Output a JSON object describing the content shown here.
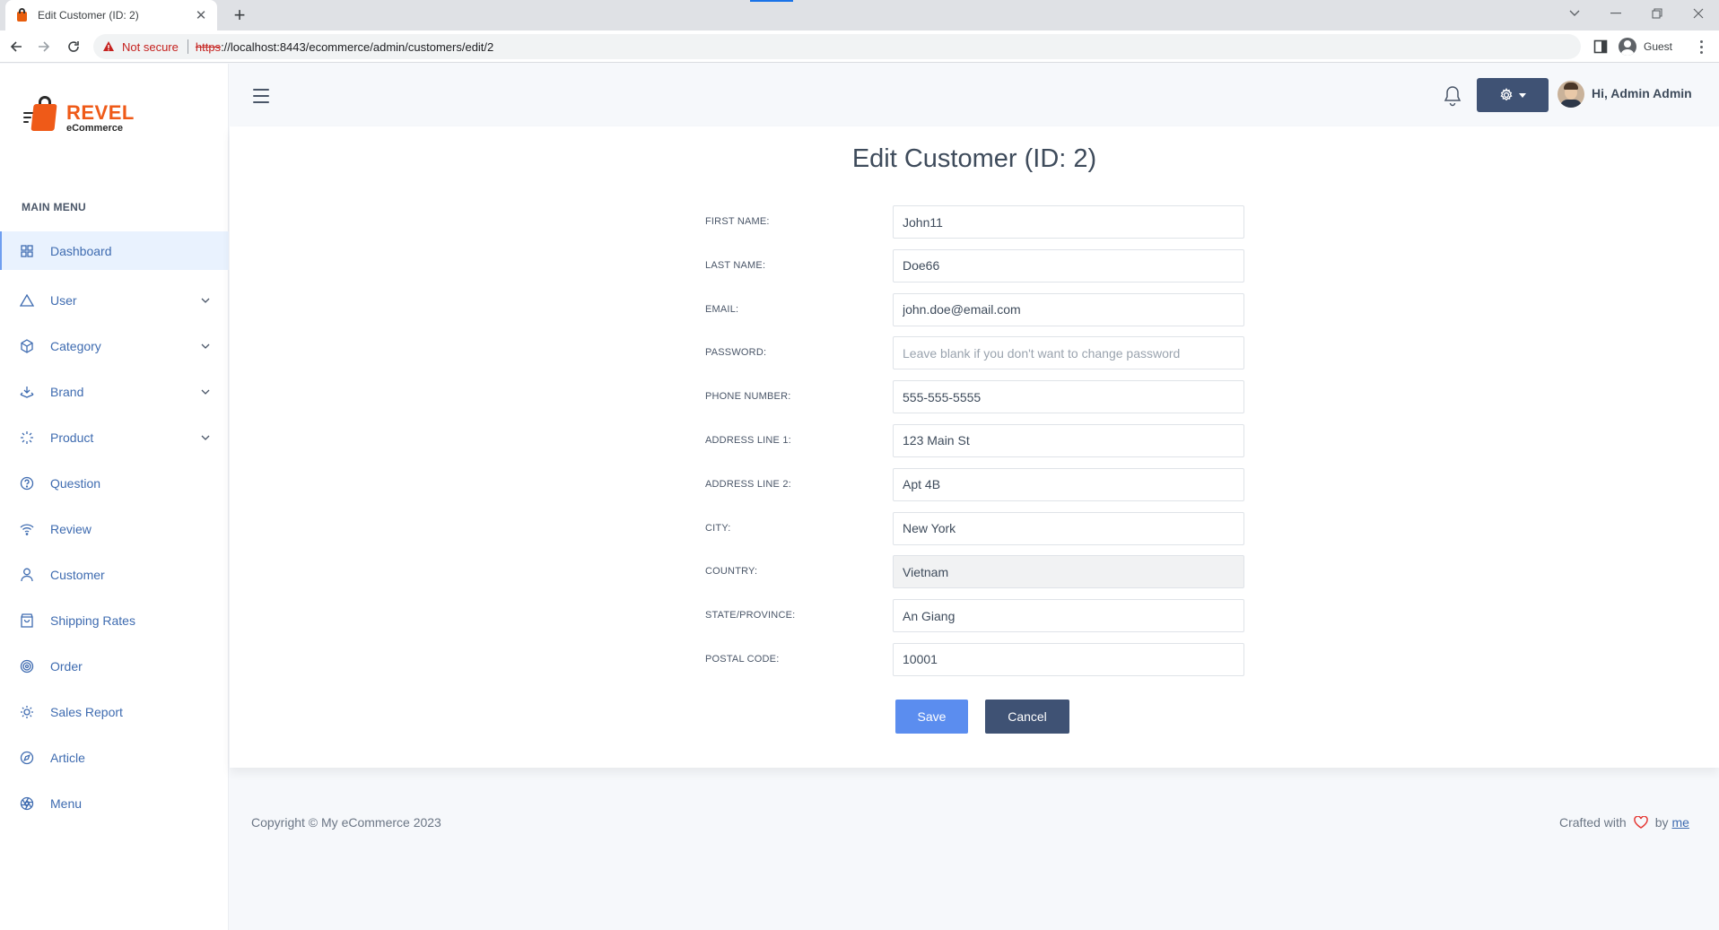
{
  "browser": {
    "tab_title": "Edit Customer (ID: 2)",
    "tab_close": "✕",
    "new_tab": "+",
    "not_secure": "Not secure",
    "url_scheme": "https",
    "url_rest": "://localhost:8443/ecommerce/admin/customers/edit/2",
    "profile_label": "Guest"
  },
  "logo": {
    "brand": "REVEL",
    "sub": "eCommerce",
    "brand_color": "#ef5a18"
  },
  "sidebar": {
    "title": "MAIN MENU",
    "items": [
      {
        "label": "Dashboard",
        "icon": "grid-icon",
        "active": true,
        "expandable": false
      },
      {
        "label": "User",
        "icon": "triangle-icon",
        "active": false,
        "expandable": true
      },
      {
        "label": "Category",
        "icon": "cube-icon",
        "active": false,
        "expandable": true
      },
      {
        "label": "Brand",
        "icon": "layers-icon",
        "active": false,
        "expandable": true
      },
      {
        "label": "Product",
        "icon": "loader-icon",
        "active": false,
        "expandable": true
      },
      {
        "label": "Question",
        "icon": "help-circle-icon",
        "active": false,
        "expandable": false
      },
      {
        "label": "Review",
        "icon": "wifi-icon",
        "active": false,
        "expandable": false
      },
      {
        "label": "Customer",
        "icon": "user-icon",
        "active": false,
        "expandable": false
      },
      {
        "label": "Shipping Rates",
        "icon": "shopping-bag-icon",
        "active": false,
        "expandable": false
      },
      {
        "label": "Order",
        "icon": "target-icon",
        "active": false,
        "expandable": false
      },
      {
        "label": "Sales Report",
        "icon": "sun-icon",
        "active": false,
        "expandable": false
      },
      {
        "label": "Article",
        "icon": "compass-icon",
        "active": false,
        "expandable": false
      },
      {
        "label": "Menu",
        "icon": "aperture-icon",
        "active": false,
        "expandable": false
      }
    ]
  },
  "header": {
    "greeting": "Hi, Admin Admin"
  },
  "page": {
    "title": "Edit Customer (ID: 2)"
  },
  "form": {
    "fields": [
      {
        "label": "FIRST NAME:",
        "value": "John11",
        "placeholder": "",
        "readonly": false
      },
      {
        "label": "LAST NAME:",
        "value": "Doe66",
        "placeholder": "",
        "readonly": false
      },
      {
        "label": "EMAIL:",
        "value": "john.doe@email.com",
        "placeholder": "",
        "readonly": false
      },
      {
        "label": "PASSWORD:",
        "value": "",
        "placeholder": "Leave blank if you don't want to change password",
        "readonly": false
      },
      {
        "label": "PHONE NUMBER:",
        "value": "555-555-5555",
        "placeholder": "",
        "readonly": false
      },
      {
        "label": "ADDRESS LINE 1:",
        "value": "123 Main St",
        "placeholder": "",
        "readonly": false
      },
      {
        "label": "ADDRESS LINE 2:",
        "value": "Apt 4B",
        "placeholder": "",
        "readonly": false
      },
      {
        "label": "CITY:",
        "value": "New York",
        "placeholder": "",
        "readonly": false
      },
      {
        "label": "COUNTRY:",
        "value": "Vietnam",
        "placeholder": "",
        "readonly": true
      },
      {
        "label": "STATE/PROVINCE:",
        "value": "An Giang",
        "placeholder": "",
        "readonly": false
      },
      {
        "label": "POSTAL CODE:",
        "value": "10001",
        "placeholder": "",
        "readonly": false
      }
    ],
    "save_label": "Save",
    "cancel_label": "Cancel"
  },
  "footer": {
    "copyright": "Copyright © My eCommerce 2023",
    "crafted": "Crafted with",
    "by": "by",
    "link": "me"
  },
  "colors": {
    "accent": "#5b8def",
    "dark_button": "#3f5274",
    "menu_text": "#3e6bb0",
    "heart": "#e53935"
  }
}
